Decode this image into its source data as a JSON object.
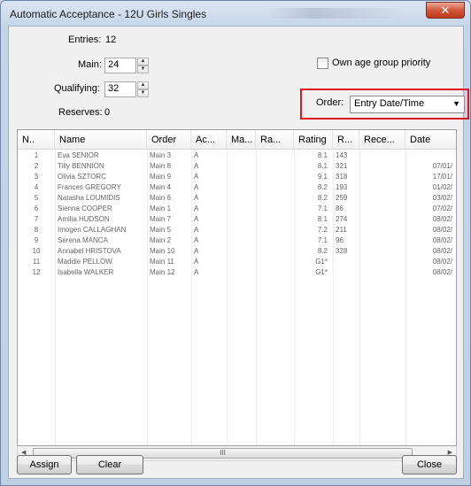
{
  "window": {
    "title": "Automatic Acceptance - 12U Girls Singles",
    "close_glyph": "✕"
  },
  "form": {
    "entries_label": "Entries:",
    "entries_value": "12",
    "main_label": "Main:",
    "main_value": "24",
    "qualifying_label": "Qualifying:",
    "qualifying_value": "32",
    "reserves_label": "Reserves:",
    "reserves_value": "0",
    "own_age_label": "Own age group priority",
    "order_label": "Order:",
    "order_value": "Entry Date/Time"
  },
  "table": {
    "columns": [
      "N..",
      "Name",
      "Order",
      "Ac...",
      "Ma...",
      "Ra...",
      "Rating",
      "R...",
      "Rece...",
      "Date"
    ],
    "rows": [
      [
        "1",
        "Eva SENIOR",
        "Main 3",
        "A",
        "",
        "",
        "8.1",
        "143",
        "",
        ""
      ],
      [
        "2",
        "Tilly BENNION",
        "Main 8",
        "A",
        "",
        "",
        "8.1",
        "321",
        "",
        "07/01/"
      ],
      [
        "3",
        "Olivia SZTORC",
        "Main 9",
        "A",
        "",
        "",
        "9.1",
        "318",
        "",
        "17/01/"
      ],
      [
        "4",
        "Frances GREGORY",
        "Main 4",
        "A",
        "",
        "",
        "8.2",
        "193",
        "",
        "01/02/"
      ],
      [
        "5",
        "Natasha LOUMIDIS",
        "Main 6",
        "A",
        "",
        "",
        "8.2",
        "259",
        "",
        "03/02/"
      ],
      [
        "6",
        "Sienna COOPER",
        "Main 1",
        "A",
        "",
        "",
        "7.1",
        "86",
        "",
        "07/02/"
      ],
      [
        "7",
        "Amilia HUDSON",
        "Main 7",
        "A",
        "",
        "",
        "8.1",
        "274",
        "",
        "08/02/"
      ],
      [
        "8",
        "Imogen CALLAGHAN",
        "Main 5",
        "A",
        "",
        "",
        "7.2",
        "211",
        "",
        "08/02/"
      ],
      [
        "9",
        "Serena MANCA",
        "Main 2",
        "A",
        "",
        "",
        "7.1",
        "96",
        "",
        "08/02/"
      ],
      [
        "10",
        "Annabel HRISTOVA",
        "Main 10",
        "A",
        "",
        "",
        "8.2",
        "328",
        "",
        "08/02/"
      ],
      [
        "11",
        "Maddie PELLOW",
        "Main 11",
        "A",
        "",
        "",
        "G1*",
        "",
        "",
        "08/02/"
      ],
      [
        "12",
        "Isabella WALKER",
        "Main 12",
        "A",
        "",
        "",
        "G1*",
        "",
        "",
        "08/02/"
      ]
    ]
  },
  "scrollbar": {
    "left_arrow": "◀",
    "right_arrow": "▶",
    "grip": "III"
  },
  "buttons": {
    "assign": "Assign",
    "clear": "Clear",
    "close": "Close"
  }
}
